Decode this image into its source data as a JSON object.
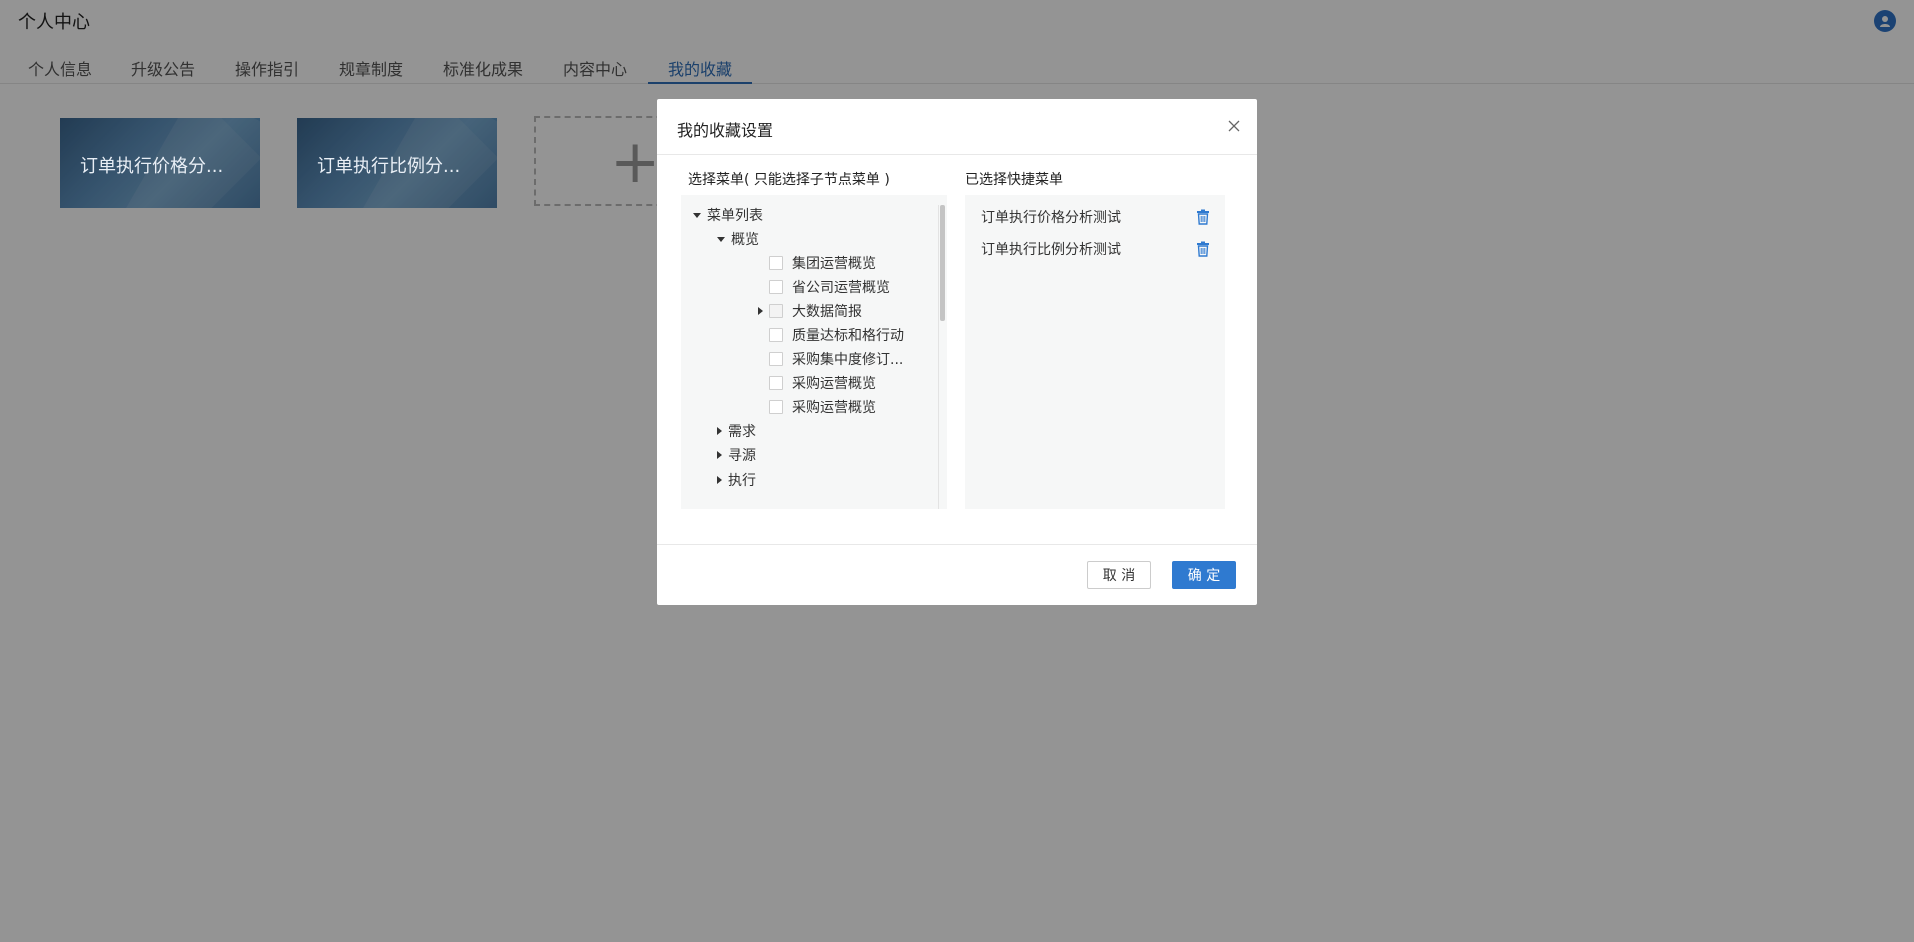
{
  "header": {
    "title": "个人中心",
    "user_icon": "user-icon"
  },
  "tabs": [
    {
      "label": "个人信息"
    },
    {
      "label": "升级公告"
    },
    {
      "label": "操作指引"
    },
    {
      "label": "规章制度"
    },
    {
      "label": "标准化成果"
    },
    {
      "label": "内容中心"
    },
    {
      "label": "我的收藏",
      "active": true
    }
  ],
  "cards": [
    {
      "label": "订单执行价格分..."
    },
    {
      "label": "订单执行比例分..."
    }
  ],
  "add_card": {
    "icon": "plus-icon",
    "glyph": "+"
  },
  "modal": {
    "title": "我的收藏设置",
    "left_section_label": "选择菜单( 只能选择子节点菜单 )",
    "right_section_label": "已选择快捷菜单",
    "tree": {
      "root": "菜单列表",
      "group_overview": "概览",
      "overview_items": [
        {
          "label": "集团运营概览"
        },
        {
          "label": "省公司运营概览"
        },
        {
          "label": "大数据简报",
          "expandable": true
        },
        {
          "label": "质量达标和格行动"
        },
        {
          "label": "采购集中度修订..."
        },
        {
          "label": "采购运营概览"
        },
        {
          "label": "采购运营概览"
        }
      ],
      "other_groups": [
        {
          "label": "需求"
        },
        {
          "label": "寻源"
        },
        {
          "label": "执行"
        }
      ]
    },
    "selected_items": [
      {
        "label": "订单执行价格分析测试"
      },
      {
        "label": "订单执行比例分析测试"
      }
    ],
    "cancel_label": "取 消",
    "confirm_label": "确 定"
  },
  "colors": {
    "accent": "#2f7ad0",
    "active_tab": "#2f6fb9",
    "overlay": "rgba(0,0,0,0.42)",
    "panel_bg": "#f6f7f7"
  }
}
